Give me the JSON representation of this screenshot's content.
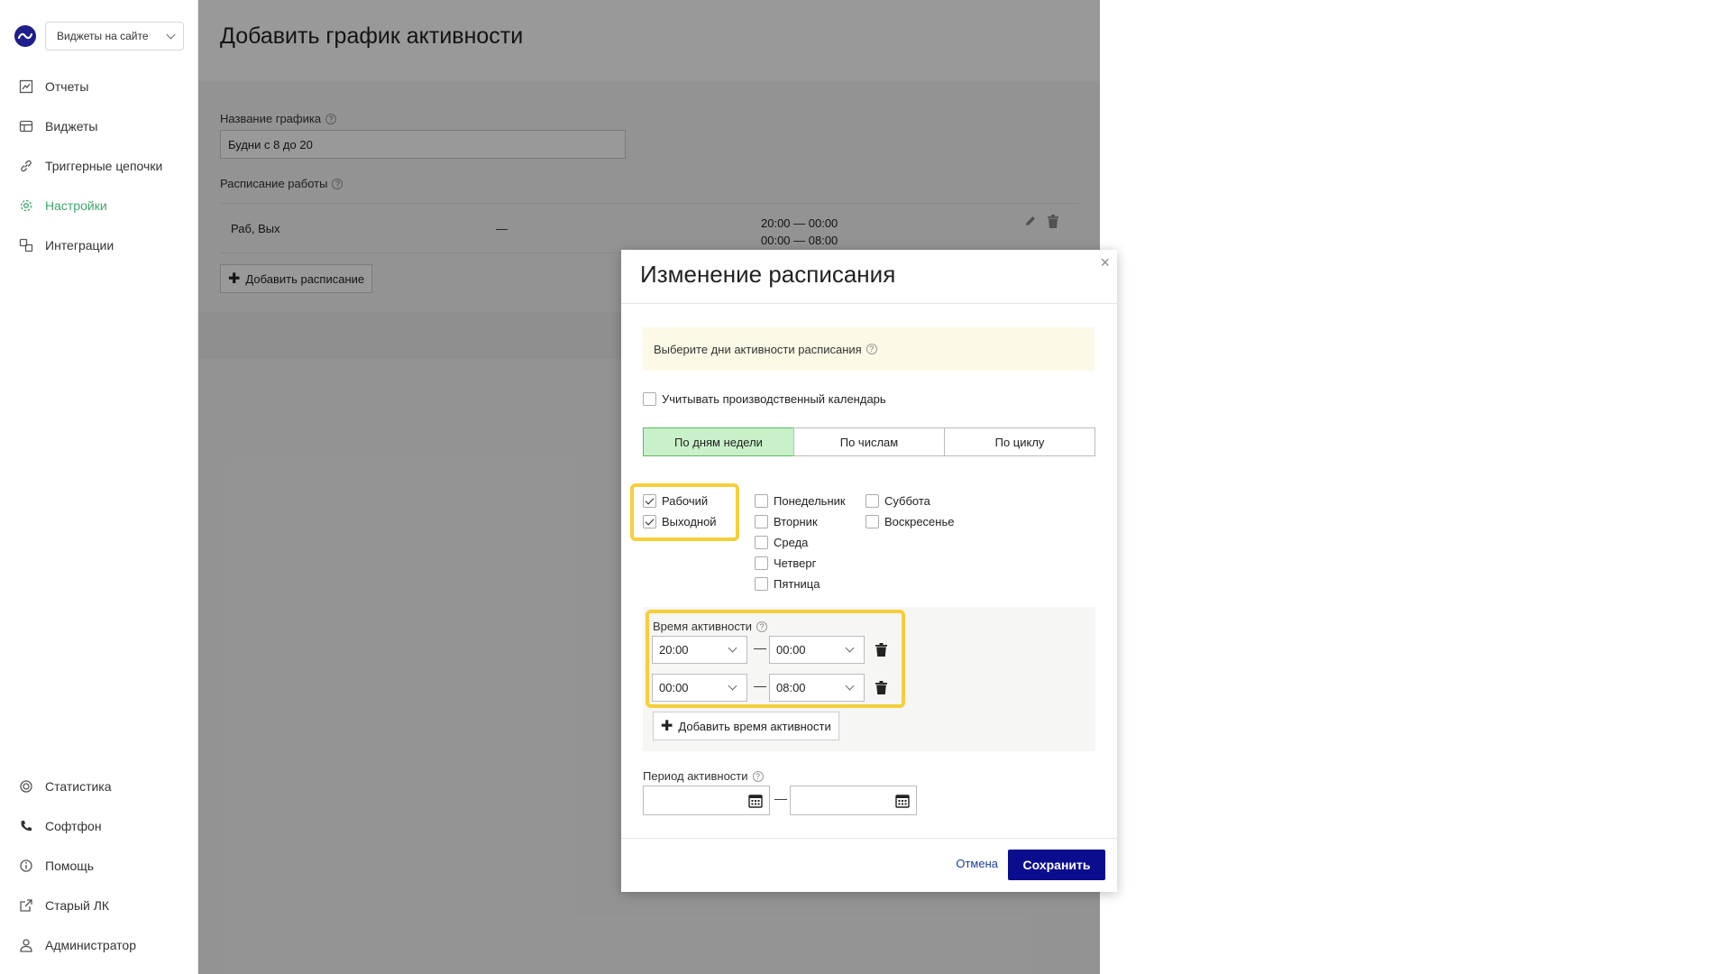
{
  "sidebar": {
    "site_select": "Виджеты на сайте",
    "items": [
      {
        "label": "Отчеты",
        "icon": "chart-icon"
      },
      {
        "label": "Виджеты",
        "icon": "widgets-icon"
      },
      {
        "label": "Триггерные цепочки",
        "icon": "link-icon"
      },
      {
        "label": "Настройки",
        "icon": "gear-icon",
        "active": true
      },
      {
        "label": "Интеграции",
        "icon": "integrations-icon"
      }
    ],
    "bottom_items": [
      {
        "label": "Статистика",
        "icon": "stats-icon"
      },
      {
        "label": "Софтфон",
        "icon": "phone-icon"
      },
      {
        "label": "Помощь",
        "icon": "help-icon"
      },
      {
        "label": "Старый ЛК",
        "icon": "external-link-icon"
      },
      {
        "label": "Администратор",
        "icon": "user-icon"
      }
    ]
  },
  "main": {
    "title": "Добавить график активности",
    "name_label": "Название графика",
    "name_value": "Будни с 8 до 20",
    "schedule_label": "Расписание работы",
    "schedule_row": {
      "days": "Раб, Вых",
      "dash": "—",
      "time1": "20:00 — 00:00",
      "time2": "00:00 — 08:00"
    },
    "add_schedule": "Добавить расписание"
  },
  "modal": {
    "title": "Изменение расписания",
    "close": "×",
    "hint": "Выберите дни активности расписания",
    "calendar_check": "Учитывать производственный календарь",
    "tabs": [
      "По дням недели",
      "По числам",
      "По циклу"
    ],
    "day_types": [
      {
        "label": "Рабочий",
        "checked": true
      },
      {
        "label": "Выходной",
        "checked": true
      }
    ],
    "weekdays_col1": [
      "Понедельник",
      "Вторник",
      "Среда",
      "Четверг",
      "Пятница"
    ],
    "weekdays_col2": [
      "Суббота",
      "Воскресенье"
    ],
    "times_label": "Время активности",
    "time_rows": [
      {
        "from": "20:00",
        "to": "00:00"
      },
      {
        "from": "00:00",
        "to": "08:00"
      }
    ],
    "dash": "—",
    "add_time": "Добавить время активности",
    "period_label": "Период активности",
    "cancel": "Отмена",
    "save": "Сохранить"
  },
  "colors": {
    "accent_green": "#3ca66b",
    "save_button": "#0b0d8f",
    "highlight": "#f5cf3b"
  }
}
